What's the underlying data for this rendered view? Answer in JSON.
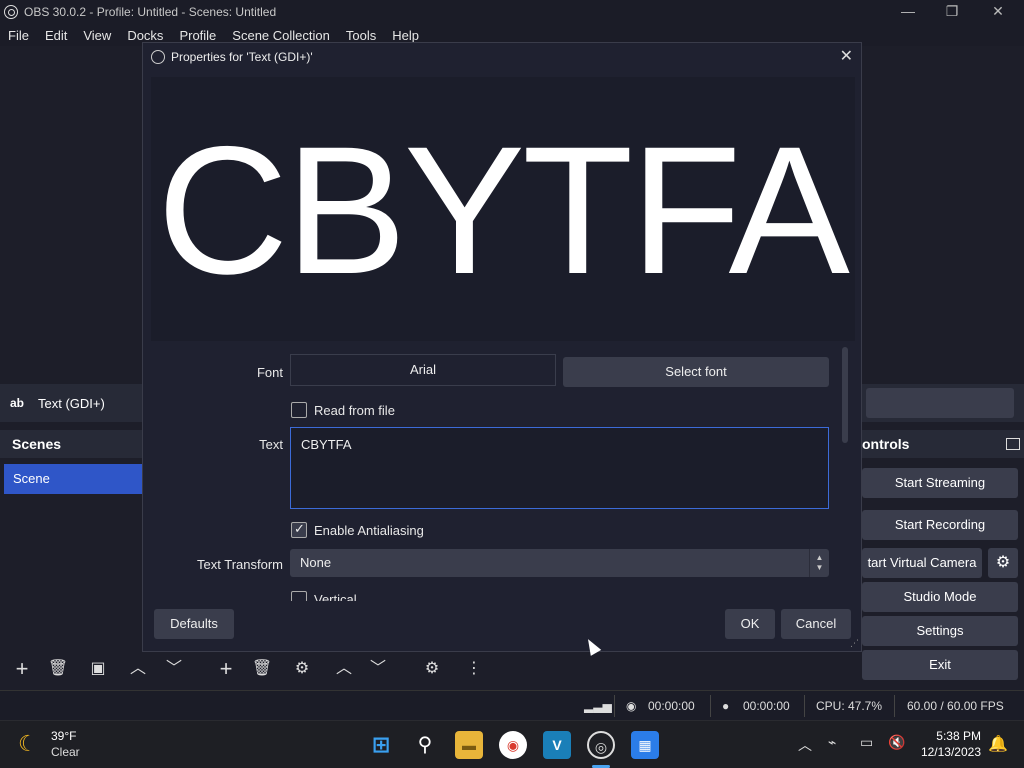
{
  "window": {
    "title": "OBS 30.0.2 - Profile: Untitled - Scenes: Untitled",
    "minimize": "—",
    "maximize": "❐",
    "close": "✕"
  },
  "menu": [
    "File",
    "Edit",
    "View",
    "Docks",
    "Profile",
    "Scene Collection",
    "Tools",
    "Help"
  ],
  "source_bar": {
    "icon": "ab",
    "label": "Text (GDI+)"
  },
  "scenes": {
    "header": "Scenes",
    "items": [
      "Scene"
    ]
  },
  "controls": {
    "header": "ontrols",
    "buttons": [
      "Start Streaming",
      "Start Recording",
      "tart Virtual Camera",
      "Studio Mode",
      "Settings",
      "Exit"
    ]
  },
  "statusbar": {
    "stream_time": "00:00:00",
    "rec_time": "00:00:00",
    "cpu": "CPU: 47.7%",
    "fps": "60.00 / 60.00 FPS"
  },
  "dialog": {
    "title": "Properties for 'Text (GDI+)'",
    "preview_text": "CBYTFA",
    "font_label": "Font",
    "font_value": "Arial",
    "select_font_label": "Select font",
    "read_from_file_label": "Read from file",
    "text_label": "Text",
    "text_value": "CBYTFA",
    "antialiasing_label": "Enable Antialiasing",
    "transform_label": "Text Transform",
    "transform_value": "None",
    "vertical_label": "Vertical",
    "defaults_label": "Defaults",
    "ok_label": "OK",
    "cancel_label": "Cancel"
  },
  "taskbar": {
    "weather_temp": "39°F",
    "weather_desc": "Clear",
    "time": "5:38 PM",
    "date": "12/13/2023"
  },
  "colors": {
    "accent": "#2f56c8",
    "focus_border": "#3c6bd8",
    "button": "#3a3d4c",
    "background": "#1d1e29"
  }
}
